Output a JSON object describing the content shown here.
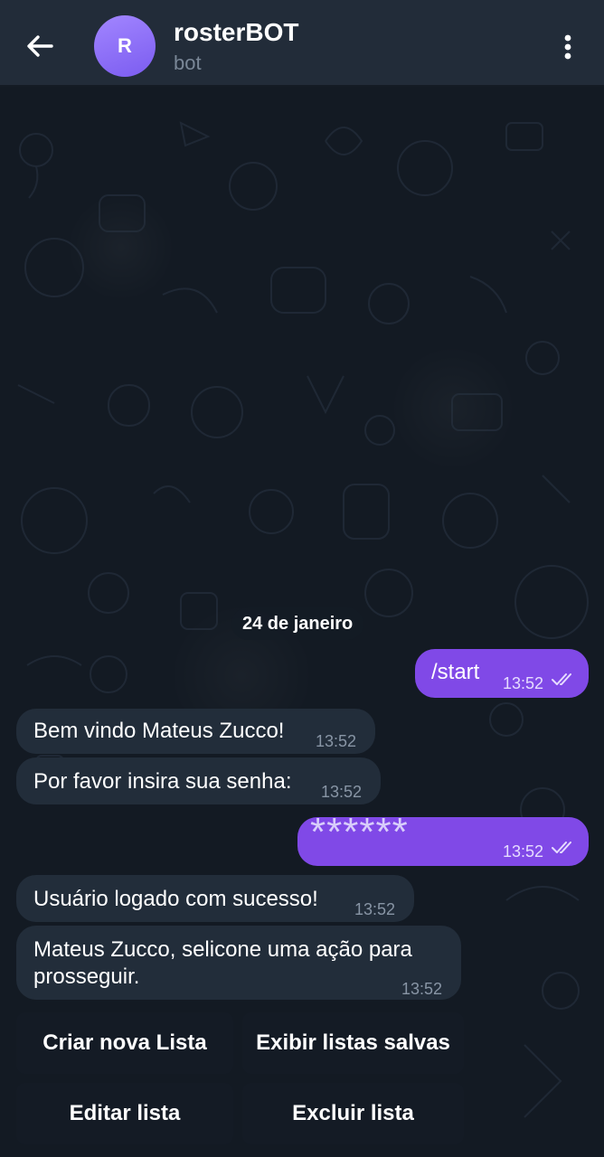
{
  "header": {
    "back_icon": "arrow-left-icon",
    "avatar_letter": "R",
    "title": "rosterBOT",
    "subtitle": "bot",
    "menu_icon": "more-vertical-icon"
  },
  "chat": {
    "date_label": "24 de janeiro",
    "messages": [
      {
        "direction": "out",
        "text": "/start",
        "time": "13:52",
        "status": "read"
      },
      {
        "direction": "in",
        "text": "Bem vindo Mateus Zucco!",
        "time": "13:52"
      },
      {
        "direction": "in",
        "text": "Por favor insira sua senha:",
        "time": "13:52"
      },
      {
        "direction": "out",
        "text": "******",
        "time": "13:52",
        "status": "read"
      },
      {
        "direction": "in",
        "text": "Usuário logado com sucesso!",
        "time": "13:52"
      },
      {
        "direction": "in",
        "text": "Mateus Zucco, selicone uma ação para prosseguir.",
        "time": "13:52"
      }
    ]
  },
  "keyboard": {
    "buttons": [
      "Criar nova Lista",
      "Exibir listas salvas",
      "Editar lista",
      "Excluir lista"
    ]
  },
  "colors": {
    "header_bg": "#222c39",
    "incoming_bubble": "#222d3a",
    "outgoing_bubble": "#8049e7",
    "avatar_accent": "#8f6ff7"
  }
}
